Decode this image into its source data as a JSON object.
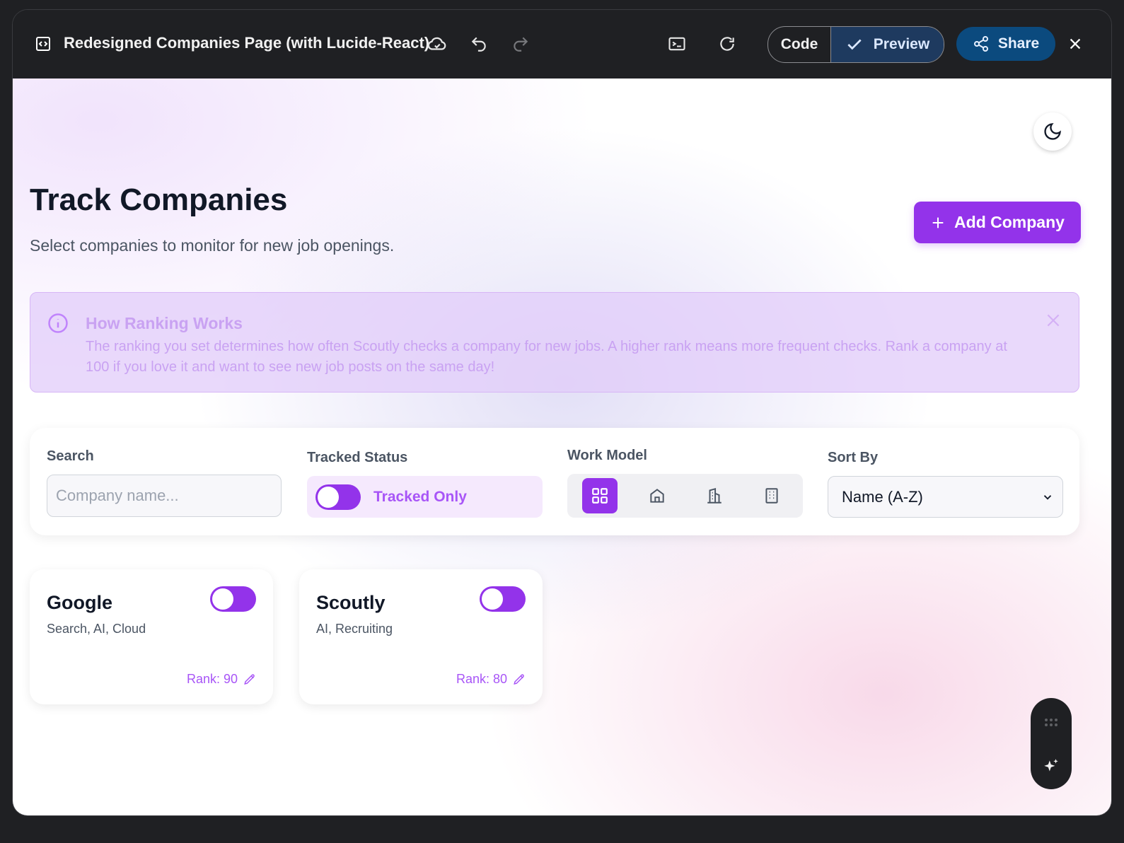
{
  "window": {
    "title": "Redesigned Companies Page (with Lucide-React)",
    "icons": [
      "code-file-icon",
      "cloud-icon",
      "undo-icon",
      "redo-icon",
      "terminal-icon",
      "refresh-icon",
      "close-icon"
    ],
    "view_toggle": {
      "code_label": "Code",
      "preview_label": "Preview",
      "selected": "Preview"
    },
    "share_label": "Share"
  },
  "page": {
    "heading": "Track Companies",
    "subheading": "Select companies to monitor for new job openings.",
    "add_button_label": "Add Company",
    "info_banner": {
      "title": "How Ranking Works",
      "text": "The ranking you set determines how often Scoutly checks a company for new jobs. A higher rank means more frequent checks. Rank a company at 100 if you love it and want to see new job posts on the same day!"
    },
    "filters": {
      "search_label": "Search",
      "search_placeholder": "Company name...",
      "search_value": "",
      "tracked_label": "Tracked Status",
      "tracked_toggle_label": "Tracked Only",
      "work_model_label": "Work Model",
      "work_model_options": [
        "all-grid-icon",
        "remote-home-icon",
        "hybrid-building-icon",
        "onsite-office-icon"
      ],
      "work_model_selected": "all-grid-icon",
      "sort_label": "Sort By",
      "sort_value": "Name (A-Z)"
    },
    "companies": [
      {
        "name": "Google",
        "tags": "Search, AI, Cloud",
        "rank_label": "Rank: 90"
      },
      {
        "name": "Scoutly",
        "tags": "AI, Recruiting",
        "rank_label": "Rank: 80"
      }
    ]
  },
  "colors": {
    "accent": "#9333ea",
    "accent_light": "#a855f7",
    "topbar": "#1f2023",
    "share_button": "#0b4a7e",
    "info_banner_bg": "#e2ccfa"
  }
}
